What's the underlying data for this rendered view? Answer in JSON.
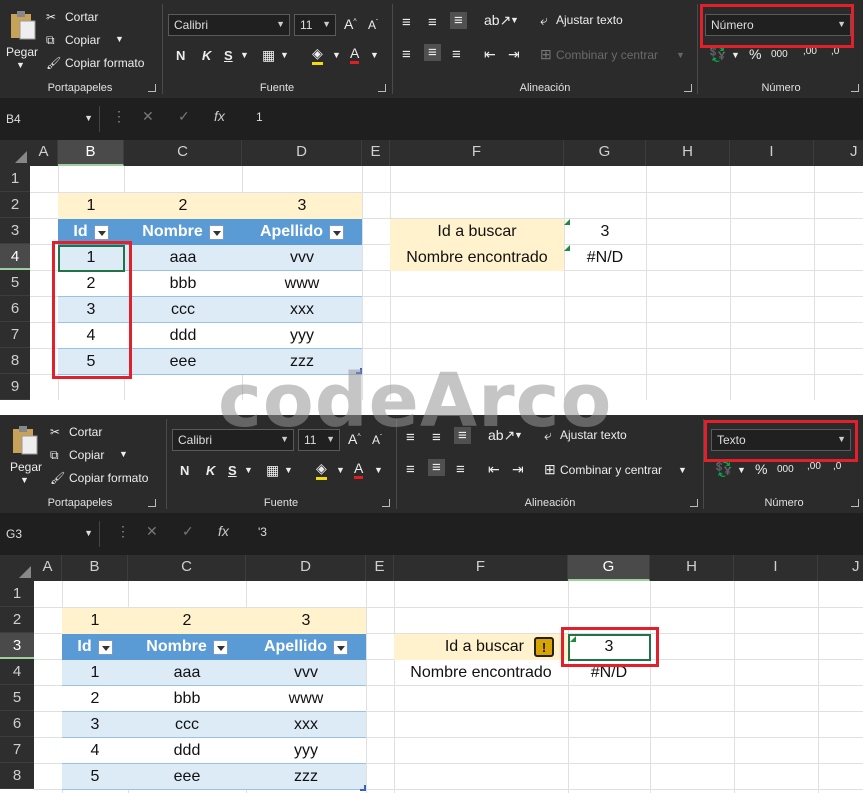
{
  "ribbon": {
    "clipboard": {
      "paste": "Pegar",
      "cut": "Cortar",
      "copy": "Copiar",
      "format_painter": "Copiar formato",
      "label": "Portapapeles"
    },
    "font": {
      "name": "Calibri",
      "size": "11",
      "bold": "N",
      "italic": "K",
      "underline": "S",
      "label": "Fuente"
    },
    "alignment": {
      "wrap_text": "Ajustar texto",
      "merge_center": "Combinar y centrar",
      "label": "Alineación"
    },
    "number": {
      "label": "Número",
      "percent": "%",
      "thousands": "000",
      "inc_dec": ",00",
      "dec_dec": ",0"
    }
  },
  "panels": [
    {
      "number_format": "Número",
      "name_box": "B4",
      "formula_value": "1",
      "selected_col": "B",
      "selected_row": "4",
      "merge_center_disabled": true
    },
    {
      "number_format": "Texto",
      "name_box": "G3",
      "formula_value": "'3",
      "selected_col": "G",
      "selected_row": "3",
      "merge_center_disabled": false
    }
  ],
  "columns": [
    "A",
    "B",
    "C",
    "D",
    "E",
    "F",
    "G",
    "H",
    "I",
    "J"
  ],
  "rows": [
    "1",
    "2",
    "3",
    "4",
    "5",
    "6",
    "7",
    "8",
    "9"
  ],
  "sheet": {
    "row2": [
      "1",
      "2",
      "3"
    ],
    "headers": [
      "Id",
      "Nombre",
      "Apellido"
    ],
    "table": [
      [
        "1",
        "aaa",
        "vvv"
      ],
      [
        "2",
        "bbb",
        "www"
      ],
      [
        "3",
        "ccc",
        "xxx"
      ],
      [
        "4",
        "ddd",
        "yyy"
      ],
      [
        "5",
        "eee",
        "zzz"
      ]
    ],
    "lookup_label": "Id a buscar",
    "lookup_value": "3",
    "result_label": "Nombre encontrado",
    "result_value": "#N/D"
  },
  "watermark": "codeArco",
  "colors": {
    "ribbon_bg": "#2b2b2b",
    "table_header": "#5b9bd5",
    "band": "#ddebf7",
    "label_fill": "#fff2cc",
    "highlight": "#e0212b"
  }
}
